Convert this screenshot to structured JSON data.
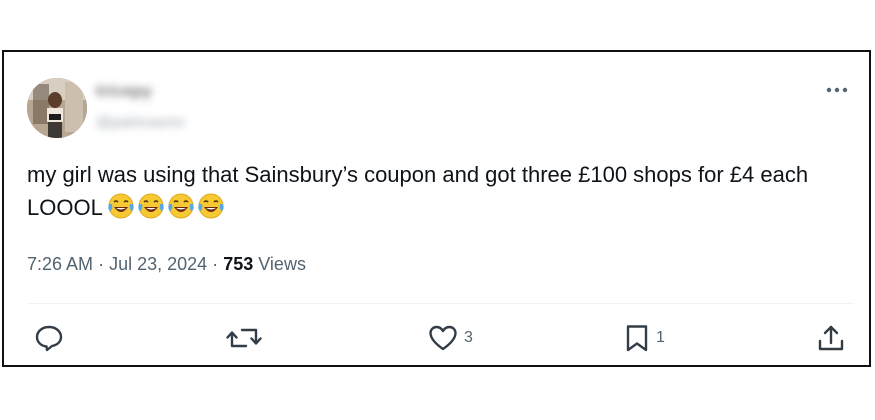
{
  "author": {
    "name": "tricepy",
    "handle": "@patricasmn"
  },
  "tweet": {
    "text": "my girl was using that Sainsbury’s coupon and got three £100 shops for £4 each LOOOL",
    "emojis": [
      "face-with-tears-of-joy",
      "face-with-tears-of-joy",
      "face-with-tears-of-joy",
      "face-with-tears-of-joy"
    ]
  },
  "meta": {
    "time": "7:26 AM",
    "separator": "·",
    "date": "Jul 23, 2024",
    "views_count": "753",
    "views_label": "Views"
  },
  "actions": {
    "reply_count": "",
    "retweet_count": "",
    "like_count": "3",
    "bookmark_count": "1"
  },
  "icons": {
    "more": "more-horizontal-icon",
    "reply": "reply-icon",
    "retweet": "retweet-icon",
    "like": "heart-icon",
    "bookmark": "bookmark-icon",
    "share": "share-icon"
  },
  "colors": {
    "text": "#0f1419",
    "secondary": "#536471",
    "divider": "#eff3f4",
    "border": "#111111",
    "emoji_yellow": "#f6c933",
    "emoji_tear": "#5aa7e6"
  }
}
